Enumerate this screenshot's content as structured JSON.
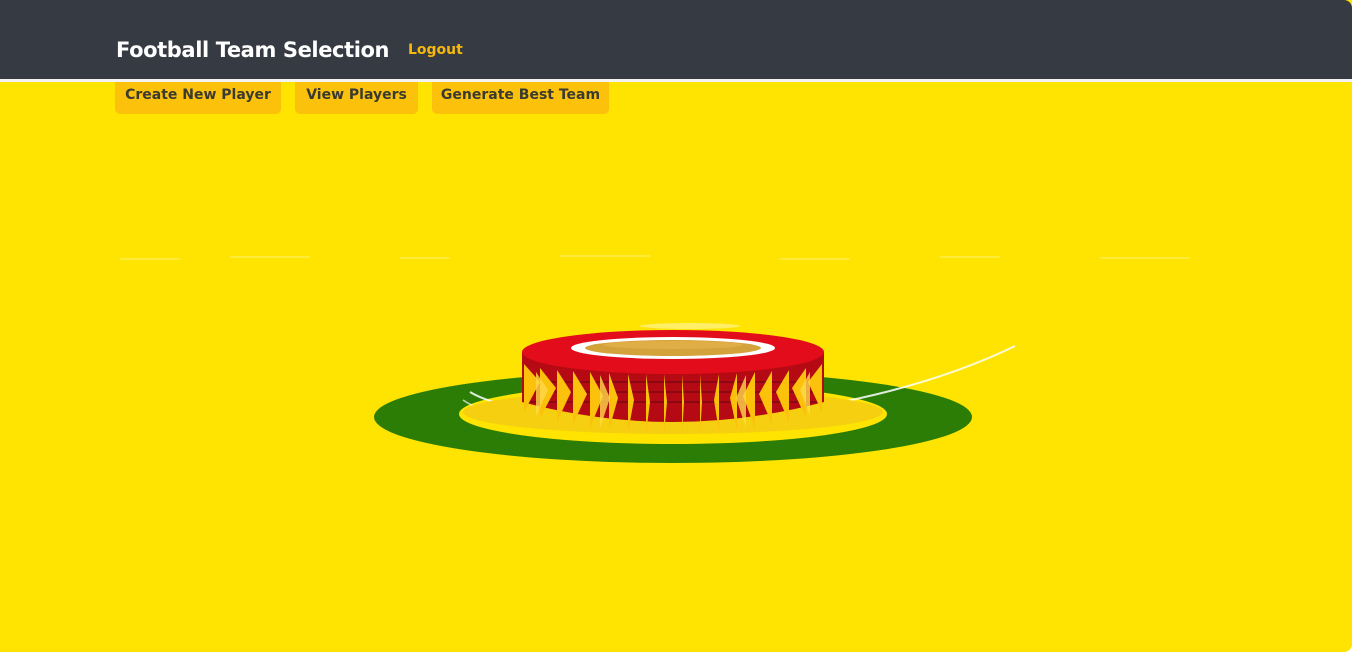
{
  "navbar": {
    "brand": "Football Team Selection",
    "logout_label": "Logout"
  },
  "actions": {
    "create_player_label": "Create New Player",
    "view_players_label": "View Players",
    "generate_team_label": "Generate Best Team"
  },
  "hero": {
    "illustration": "stadium-illustration",
    "background_color": "#fee400",
    "ring_color": "#2b7d06",
    "roof_color": "#e20c1a"
  },
  "colors": {
    "navbar_bg": "#363a42",
    "accent": "#f6b80d",
    "button_bg": "#fcc10b"
  }
}
